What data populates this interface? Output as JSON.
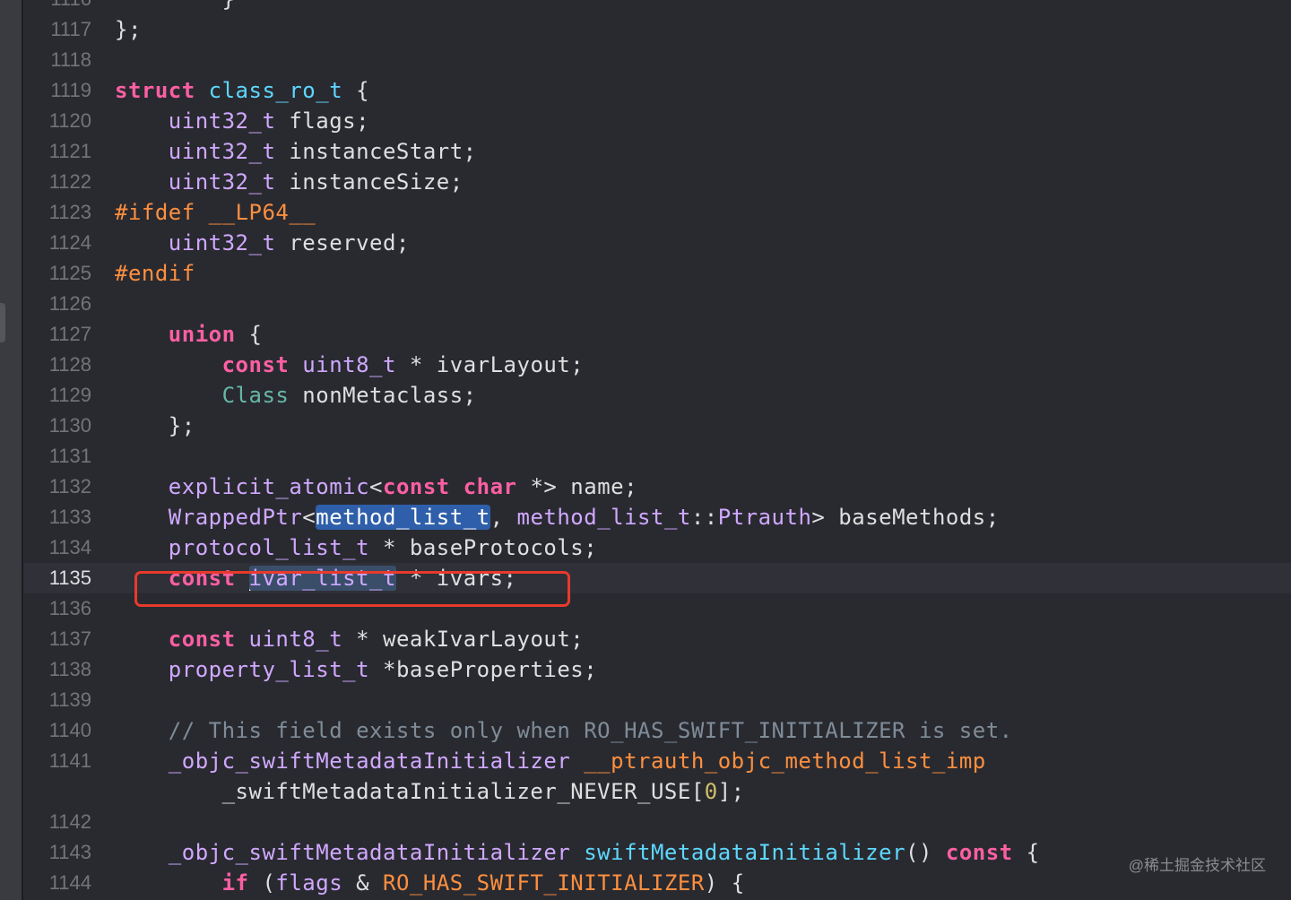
{
  "editor": {
    "lines": [
      {
        "no": "1116",
        "code": "        }"
      },
      {
        "no": "1117",
        "code": "};"
      },
      {
        "no": "1118",
        "code": ""
      },
      {
        "no": "1119",
        "code": "struct class_ro_t {"
      },
      {
        "no": "1120",
        "code": "    uint32_t flags;"
      },
      {
        "no": "1121",
        "code": "    uint32_t instanceStart;"
      },
      {
        "no": "1122",
        "code": "    uint32_t instanceSize;"
      },
      {
        "no": "1123",
        "code": "#ifdef __LP64__"
      },
      {
        "no": "1124",
        "code": "    uint32_t reserved;"
      },
      {
        "no": "1125",
        "code": "#endif"
      },
      {
        "no": "1126",
        "code": ""
      },
      {
        "no": "1127",
        "code": "    union {"
      },
      {
        "no": "1128",
        "code": "        const uint8_t * ivarLayout;"
      },
      {
        "no": "1129",
        "code": "        Class nonMetaclass;"
      },
      {
        "no": "1130",
        "code": "    };"
      },
      {
        "no": "1131",
        "code": ""
      },
      {
        "no": "1132",
        "code": "    explicit_atomic<const char *> name;"
      },
      {
        "no": "1133",
        "code": "    WrappedPtr<method_list_t, method_list_t::Ptrauth> baseMethods;"
      },
      {
        "no": "1134",
        "code": "    protocol_list_t * baseProtocols;"
      },
      {
        "no": "1135",
        "code": "    const ivar_list_t * ivars;"
      },
      {
        "no": "1136",
        "code": ""
      },
      {
        "no": "1137",
        "code": "    const uint8_t * weakIvarLayout;"
      },
      {
        "no": "1138",
        "code": "    property_list_t *baseProperties;"
      },
      {
        "no": "1139",
        "code": ""
      },
      {
        "no": "1140",
        "code": "    // This field exists only when RO_HAS_SWIFT_INITIALIZER is set."
      },
      {
        "no": "1141",
        "code": "    _objc_swiftMetadataInitializer __ptrauth_objc_method_list_imp"
      },
      {
        "no": "",
        "code": "        _swiftMetadataInitializer_NEVER_USE[0];"
      },
      {
        "no": "1142",
        "code": ""
      },
      {
        "no": "1143",
        "code": "    _objc_swiftMetadataInitializer swiftMetadataInitializer() const {"
      },
      {
        "no": "1144",
        "code": "        if (flags & RO_HAS_SWIFT_INITIALIZER) {"
      }
    ],
    "current_line": "1135",
    "highlighted_symbol": "method_list_t",
    "highlighted_line": "1133",
    "selected_symbol": "ivar_list_t",
    "boxed_line": "1135",
    "annotation_color": "#e83a2c"
  },
  "watermark": "@稀土掘金技术社区"
}
